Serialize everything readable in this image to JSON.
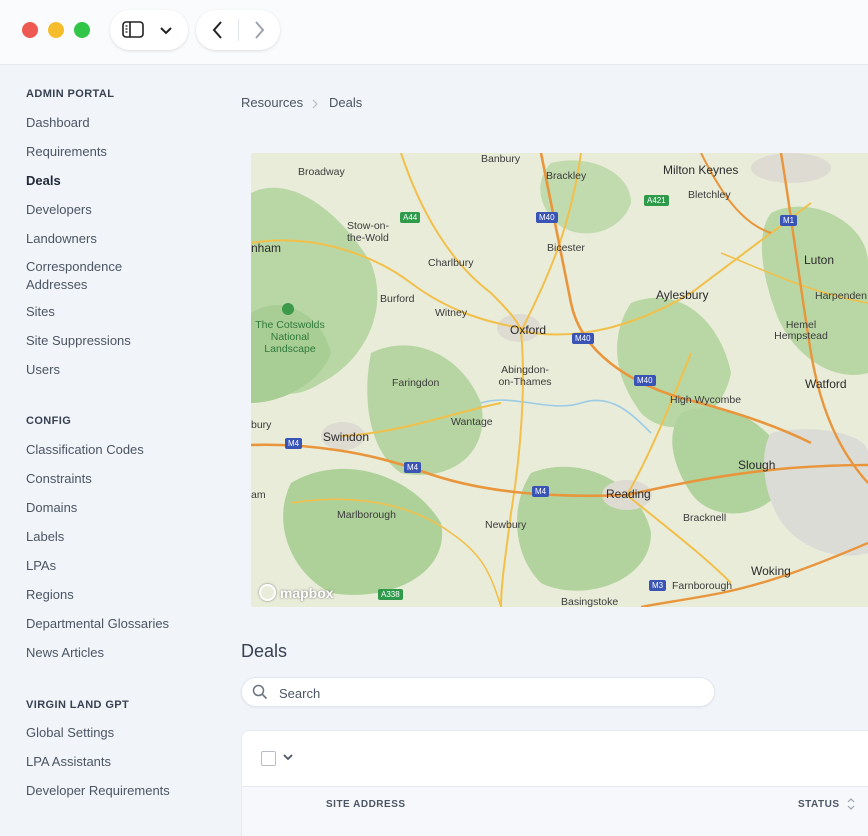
{
  "sidebar": {
    "sections": [
      {
        "title": "ADMIN PORTAL",
        "items": [
          "Dashboard",
          "Requirements",
          "Deals",
          "Developers",
          "Landowners",
          "Correspondence Addresses",
          "Sites",
          "Site Suppressions",
          "Users"
        ]
      },
      {
        "title": "CONFIG",
        "items": [
          "Classification Codes",
          "Constraints",
          "Domains",
          "Labels",
          "LPAs",
          "Regions",
          "Departmental Glossaries",
          "News Articles"
        ]
      },
      {
        "title": "VIRGIN LAND GPT",
        "items": [
          "Global Settings",
          "LPA Assistants",
          "Developer Requirements"
        ]
      }
    ],
    "active_item": "Deals"
  },
  "breadcrumb": {
    "parent": "Resources",
    "current": "Deals"
  },
  "map": {
    "attribution": "mapbox",
    "places": [
      "Banbury",
      "Milton Keynes",
      "Broadway",
      "Brackley",
      "Bletchley",
      "Stow-on-the-Wold",
      "nham",
      "Bicester",
      "Luton",
      "Charlbury",
      "Aylesbury",
      "Harpenden",
      "Burford",
      "Witney",
      "The Cotswolds National Landscape",
      "Oxford",
      "Hemel Hempstead",
      "Abingdon-on-Thames",
      "Faringdon",
      "Watford",
      "High Wycombe",
      "Wantage",
      "bury",
      "Swindon",
      "Slough",
      "Reading",
      "am",
      "Marlborough",
      "Newbury",
      "Bracknell",
      "Woking",
      "Farnborough",
      "Basingstoke"
    ],
    "road_shields": [
      "A44",
      "M40",
      "A421",
      "M1",
      "M40",
      "M40",
      "M4",
      "M4",
      "M4",
      "A338",
      "M3"
    ]
  },
  "deals": {
    "title": "Deals",
    "search_placeholder": "Search",
    "columns": [
      "SITE ADDRESS",
      "STATUS"
    ]
  },
  "colors": {
    "sidebar_bg": "#f1f4f9",
    "map_land": "#e8ecd9",
    "map_green": "#a8cd95",
    "road_motorway": "#3954b4",
    "road_primary": "#f2c04a"
  }
}
